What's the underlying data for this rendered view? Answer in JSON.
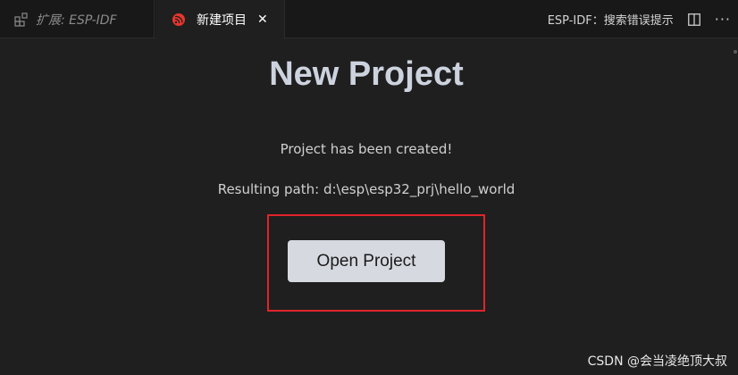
{
  "tabs": {
    "extension": {
      "label": "扩展: ESP-IDF",
      "icon": "extensions-icon"
    },
    "new_project": {
      "label": "新建项目",
      "icon": "espressif-logo-icon",
      "close": "✕"
    }
  },
  "actions": {
    "hint": "ESP-IDF：搜索错误提示",
    "split_icon": "split-editor-icon",
    "more": "···"
  },
  "main": {
    "title": "New Project",
    "status": "Project has been created!",
    "path": "Resulting path: d:\\esp\\esp32_prj\\hello_world",
    "open_button": "Open Project"
  },
  "watermark": "CSDN @会当凌绝顶大叔",
  "colors": {
    "accent_highlight": "#e0242b",
    "button_bg": "#d6d9e0",
    "logo_red": "#e8362d"
  }
}
